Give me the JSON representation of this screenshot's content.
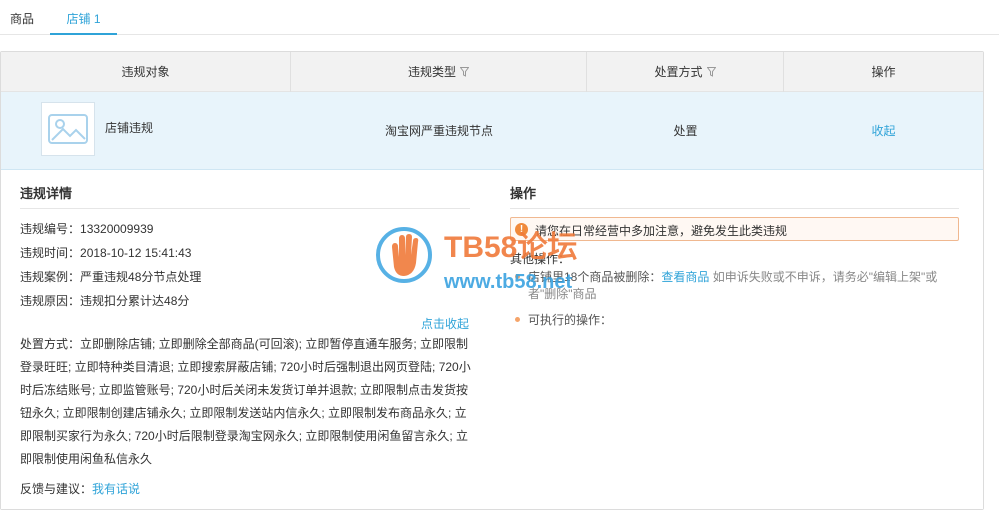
{
  "tabs": [
    "商品",
    "店铺 1"
  ],
  "table": {
    "headers": {
      "target": "违规对象",
      "type": "违规类型",
      "method": "处置方式",
      "action": "操作"
    },
    "row": {
      "name": "店铺违规",
      "type": "淘宝网严重违规节点",
      "method": "处置",
      "collapse": "收起"
    }
  },
  "detail": {
    "title": "违规详情",
    "fields": [
      {
        "label": "违规编号：",
        "value": "13320009939"
      },
      {
        "label": "违规时间：",
        "value": "2018-10-12 15:41:43"
      },
      {
        "label": "违规案例：",
        "value": "严重违规48分节点处理"
      },
      {
        "label": "违规原因：",
        "value": "违规扣分累计达48分"
      }
    ],
    "toggle": "点击收起",
    "measures": "处置方式：立即删除店铺; 立即删除全部商品(可回滚); 立即暂停直通车服务; 立即限制登录旺旺; 立即特种类目清退; 立即搜索屏蔽店铺; 720小时后强制退出网页登陆; 720小时后冻结账号; 立即监管账号; 720小时后关闭未发货订单并退款; 立即限制点击发货按钮永久; 立即限制创建店铺永久; 立即限制发送站内信永久; 立即限制发布商品永久; 立即限制买家行为永久; 720小时后限制登录淘宝网永久; 立即限制使用闲鱼留言永久; 立即限制使用闲鱼私信永久",
    "feedback_label": "反馈与建议：",
    "feedback_link": "我有话说"
  },
  "operation": {
    "title": "操作",
    "notice": "请您在日常经营中多加注意，避免发生此类违规",
    "other_title": "其他操作：",
    "item1_prefix": "店铺里18个商品被删除：",
    "item1_link": "查看商品",
    "item1_note": "如申诉失败或不申诉，请务必\"编辑上架\"或者\"删除\"商品",
    "item2": "可执行的操作："
  },
  "watermark": {
    "brand": "TB58论坛",
    "url": "www.tb58.net"
  },
  "colors": {
    "accent": "#2fa3d8",
    "row_highlight": "#e8f4fb",
    "warning": "#f08a3c"
  }
}
